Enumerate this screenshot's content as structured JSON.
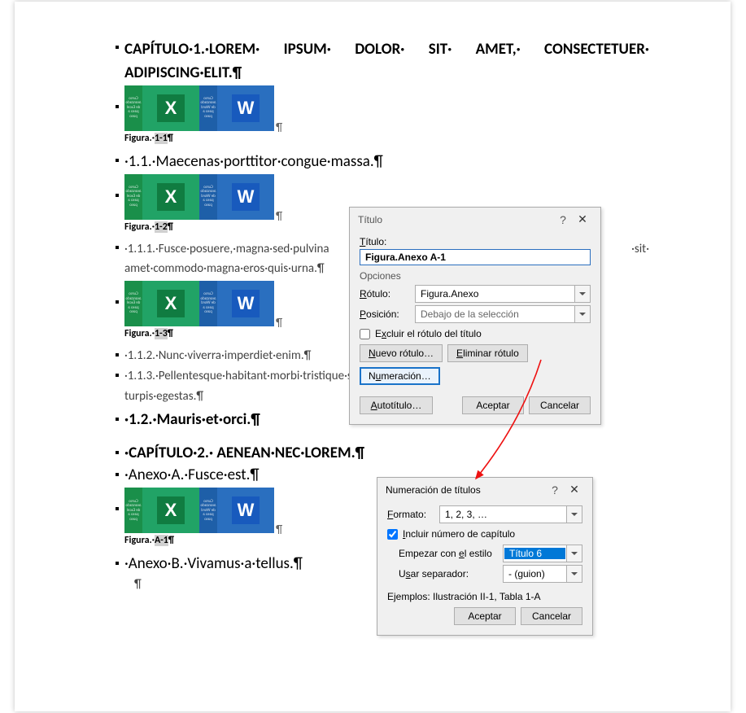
{
  "doc": {
    "h1_line1": "CAPÍTULO·1.·LOREM· IPSUM· DOLOR· SIT· AMET,· CONSECTETUER·",
    "h1_line2": "ADIPISCING·ELIT.¶",
    "cap1": "Figura.·",
    "cap1_sel": "1-1",
    "cap1_end": "¶",
    "h2_1": "·1.1.·Maecenas·porttitor·congue·massa.¶",
    "cap2": "Figura.·",
    "cap2_sel": "1-2",
    "cap2_end": "¶",
    "h3_1a": "·1.1.1.·Fusce·posuere,·magna·sed·pulvina",
    "h3_1b": "·sit·",
    "h3_1c": "amet·commodo·magna·eros·quis·urna.¶",
    "cap3": "Figura.·",
    "cap3_sel": "1-3",
    "cap3_end": "¶",
    "h3_2": "·1.1.2.·Nunc·viverra·imperdiet·enim.¶",
    "h3_3a": "·1.1.3.·Pellentesque·habitant·morbi·tristique·senectus·et·netus·et·malesuada·fames·ac·",
    "h3_3b": "turpis·egestas.¶",
    "h2_2": "·1.2.·Mauris·et·orci.¶",
    "h1_2": "·CAPÍTULO·2.· AENEAN·NEC·LOREM.¶",
    "h2_3": "·Anexo·A.·Fusce·est.¶",
    "cap4": "Figura.·",
    "cap4_sel": "A-1",
    "cap4_end": "¶",
    "h2_4": "·Anexo·B.·Vivamus·a·tellus.¶",
    "end": "¶"
  },
  "dialog1": {
    "title": "Título",
    "help": "?",
    "close": "✕",
    "lbl_titulo": "Título:",
    "lbl_titulo_u": "T",
    "input_value": "Figura.Anexo A-1",
    "opciones": "Opciones",
    "rotulo_lbl": "Rótulo:",
    "rotulo_u": "R",
    "rotulo_val": "Figura.Anexo",
    "posicion_lbl": "Posición:",
    "posicion_u": "P",
    "posicion_val": "Debajo de la selección",
    "excluir": "Excluir el rótulo del título",
    "excluir_u": "x",
    "nuevo": "Nuevo rótulo…",
    "nuevo_u": "N",
    "eliminar": "Eliminar rótulo",
    "eliminar_u": "E",
    "numeracion": "Numeración…",
    "numeracion_u": "u",
    "autotitulo": "Autotítulo…",
    "autotitulo_u": "A",
    "aceptar": "Aceptar",
    "cancelar": "Cancelar"
  },
  "dialog2": {
    "title": "Numeración de títulos",
    "help": "?",
    "close": "✕",
    "formato_lbl": "Formato:",
    "formato_u": "F",
    "formato_val": "1, 2, 3, …",
    "incluir": "Incluir número de capítulo",
    "incluir_u": "I",
    "empezar_lbl": "Empezar con el estilo",
    "empezar_u": "e",
    "empezar_val": "Título 6",
    "usar_lbl": "Usar separador:",
    "usar_u": "s",
    "usar_val": "-    (guion)",
    "ejemplos": "Ejemplos:   Ilustración II-1, Tabla 1-A",
    "aceptar": "Aceptar",
    "cancelar": "Cancelar"
  },
  "book": {
    "x": "X",
    "w": "W",
    "excel_stripe": "Curso avanzado de Excel paso a paso",
    "word_stripe": "Curso avanzado de Word paso a paso"
  }
}
